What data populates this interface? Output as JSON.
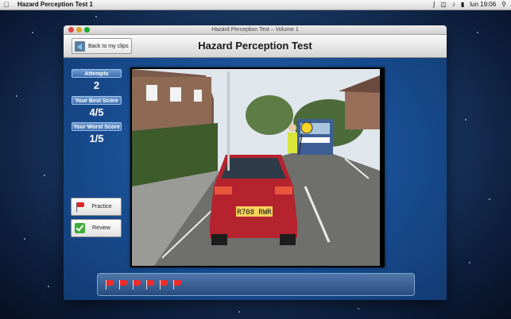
{
  "menubar": {
    "app_name": "Hazard Perception Test 1",
    "clock": "lun 19:06"
  },
  "window": {
    "title": "Hazard Perception Test – Volume 1"
  },
  "header": {
    "back_label": "Back to my clips",
    "page_title": "Hazard Perception Test"
  },
  "stats": {
    "attempts_label": "Attempts",
    "attempts_value": "2",
    "best_label": "Your Best Score",
    "best_value": "4/5",
    "worst_label": "Your Worst Score",
    "worst_value": "1/5"
  },
  "buttons": {
    "practice_label": "Practice",
    "review_label": "Review"
  },
  "video": {
    "plate_text": "R708 RWR"
  },
  "flags": {
    "count": 6,
    "color": "#ef2b2b"
  }
}
